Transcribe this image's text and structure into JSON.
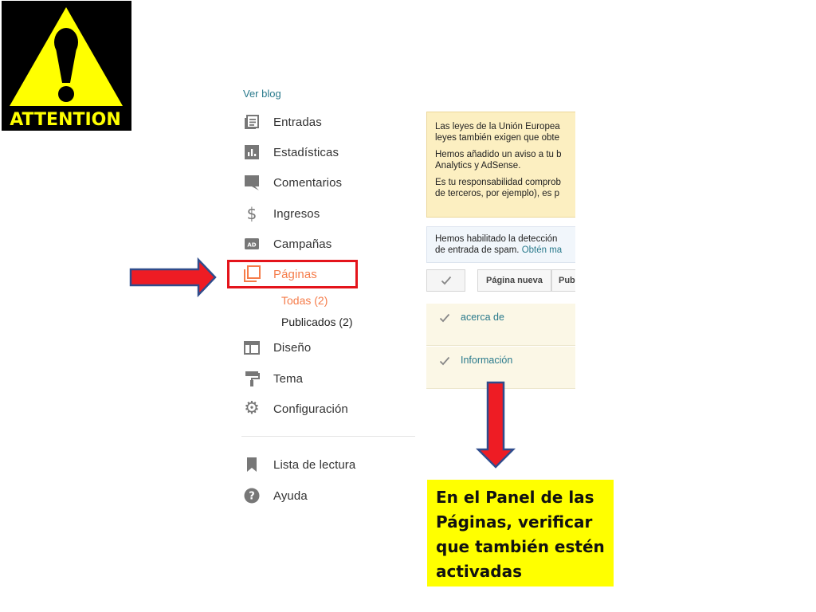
{
  "attention_sign": {
    "text": "ATTENTION",
    "icon": "warning-triangle-icon"
  },
  "sidebar": {
    "view_blog": "Ver blog",
    "items": [
      {
        "label": "Entradas",
        "icon": "posts-icon"
      },
      {
        "label": "Estadísticas",
        "icon": "stats-icon"
      },
      {
        "label": "Comentarios",
        "icon": "comments-icon"
      },
      {
        "label": "Ingresos",
        "icon": "dollar-icon"
      },
      {
        "label": "Campañas",
        "icon": "campaigns-icon"
      },
      {
        "label": "Páginas",
        "icon": "pages-icon",
        "active": true
      },
      {
        "label": "Diseño",
        "icon": "layout-icon"
      },
      {
        "label": "Tema",
        "icon": "theme-paint-roller-icon"
      },
      {
        "label": "Configuración",
        "icon": "settings-gear-icon"
      },
      {
        "label": "Lista de lectura",
        "icon": "bookmark-icon"
      },
      {
        "label": "Ayuda",
        "icon": "help-icon"
      }
    ],
    "pages_sub": [
      {
        "label": "Todas (2)",
        "active": true
      },
      {
        "label": "Publicados (2)"
      }
    ]
  },
  "main": {
    "notice_lines": [
      "Las leyes de la Unión Europea",
      "leyes también exigen que obte",
      "Hemos añadido un aviso a tu b",
      "Analytics y AdSense.",
      "Es tu responsabilidad comprob",
      "de terceros, por ejemplo), es p"
    ],
    "spam_notice_line1": "Hemos habilitado la detección",
    "spam_notice_line2": "de entrada de spam. ",
    "spam_notice_link": "Obtén ma",
    "toolbar": {
      "new_page": "Página nueva",
      "publish": "Publ"
    },
    "pages": [
      {
        "title": "acerca de"
      },
      {
        "title": "Información"
      }
    ]
  },
  "note": {
    "lines": [
      "En el Panel de las",
      "Páginas, verificar",
      "que también estén",
      "activadas"
    ]
  },
  "colors": {
    "accent": "#f57c4a",
    "link": "#2a7a8c",
    "highlight_border": "#e4141b",
    "arrow_fill": "#ee1c24",
    "arrow_stroke": "#2f4c8c",
    "note_bg": "#ffff00",
    "notice_bg": "#fcefc1"
  }
}
